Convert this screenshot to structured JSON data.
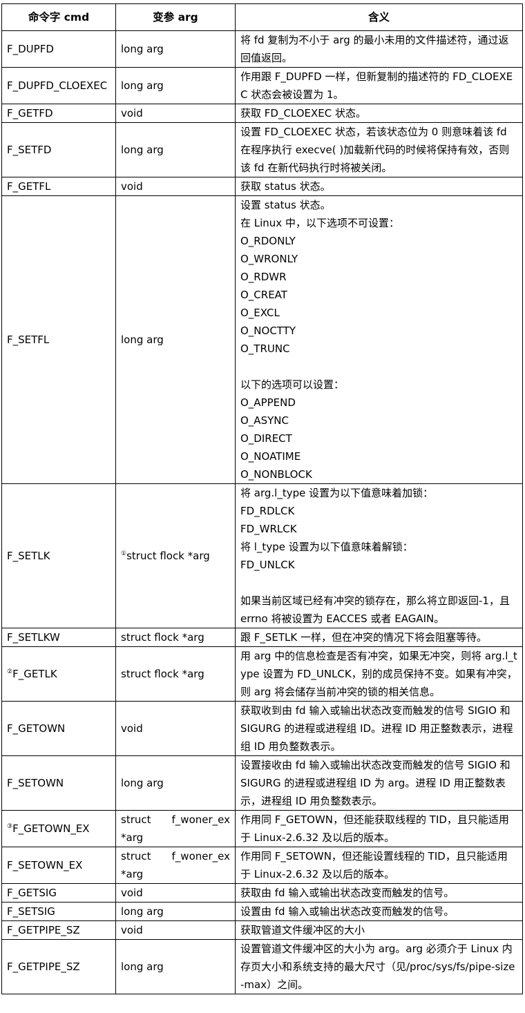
{
  "headers": [
    "命令字 cmd",
    "变参 arg",
    "含义"
  ],
  "rows": [
    {
      "cmd": "F_DUPFD",
      "arg": "long arg",
      "desc": [
        "将 fd 复制为不小于 arg 的最小未用的文件描述符，通过返回值返回。"
      ]
    },
    {
      "cmd": "F_DUPFD_CLOEXEC",
      "arg": "long arg",
      "desc": [
        "作用跟 F_DUPFD 一样，但新复制的描述符的 FD_CLOEXEC 状态会被设置为 1。"
      ]
    },
    {
      "cmd": "F_GETFD",
      "arg": "void",
      "desc": [
        "获取 FD_CLOEXEC 状态。"
      ]
    },
    {
      "cmd": "F_SETFD",
      "arg": "long arg",
      "desc": [
        "设置 FD_CLOEXEC 状态，若该状态位为 0 则意味着该 fd 在程序执行 execve( )加载新代码的时候将保持有效，否则该 fd 在新代码执行时将被关闭。"
      ]
    },
    {
      "cmd": "F_GETFL",
      "arg": "void",
      "desc": [
        "获取 status 状态。"
      ]
    },
    {
      "cmd": "F_SETFL",
      "arg": "long arg",
      "desc": [
        "设置 status 状态。",
        "在 Linux 中，以下选项不可设置：",
        "O_RDONLY",
        "O_WRONLY",
        "O_RDWR",
        "O_CREAT",
        "O_EXCL",
        "O_NOCTTY",
        "O_TRUNC",
        "",
        "以下的选项可以设置：",
        "O_APPEND",
        "O_ASYNC",
        "O_DIRECT",
        "O_NOATIME",
        "O_NONBLOCK"
      ]
    },
    {
      "cmd": "F_SETLK",
      "arg_note": "①",
      "arg": "struct flock *arg",
      "desc": [
        "将 arg.l_type 设置为以下值意味着加锁：",
        "FD_RDLCK",
        "FD_WRLCK",
        "将 l_type 设置为以下值意味着解锁：",
        "FD_UNLCK",
        "",
        "如果当前区域已经有冲突的锁存在，那么将立即返回-1，且 errno 将被设置为 EACCES 或者 EAGAIN。"
      ]
    },
    {
      "cmd": "F_SETLKW",
      "arg": "struct flock *arg",
      "desc": [
        "跟 F_SETLK 一样，但在冲突的情况下将会阻塞等待。"
      ]
    },
    {
      "cmd_note": "②",
      "cmd": "F_GETLK",
      "arg": "struct flock *arg",
      "desc": [
        "用 arg 中的信息检查是否有冲突，如果无冲突，则将 arg.l_type 设置为 FD_UNLCK，别的成员保持不变。如果有冲突，则 arg 将会储存当前冲突的锁的相关信息。"
      ]
    },
    {
      "cmd": "F_GETOWN",
      "arg": "void",
      "desc": [
        "获取收到由 fd 输入或输出状态改变而触发的信号 SIGIO 和 SIGURG 的进程或进程组 ID。进程 ID 用正整数表示，进程组 ID 用负整数表示。"
      ]
    },
    {
      "cmd": "F_SETOWN",
      "arg": "long arg",
      "desc": [
        "设置接收由 fd 输入或输出状态改变而触发的信号 SIGIO 和 SIGURG 的进程或进程组 ID 为 arg。进程 ID 用正整数表示，进程组 ID 用负整数表示。"
      ]
    },
    {
      "cmd_note": "③",
      "cmd": "F_GETOWN_EX",
      "arg_parts": [
        "struct",
        "f_woner_ex",
        "*arg"
      ],
      "desc": [
        "作用同 F_GETOWN，但还能获取线程的 TID，且只能适用于 Linux-2.6.32 及以后的版本。"
      ]
    },
    {
      "cmd": "F_SETOWN_EX",
      "arg_parts": [
        "struct",
        "f_woner_ex",
        "*arg"
      ],
      "desc": [
        "作用同 F_SETOWN，但还能设置线程的 TID，且只能适用于 Linux-2.6.32 及以后的版本。"
      ]
    },
    {
      "cmd": "F_GETSIG",
      "arg": "void",
      "desc": [
        "获取由 fd 输入或输出状态改变而触发的信号。"
      ]
    },
    {
      "cmd": "F_SETSIG",
      "arg": "long arg",
      "desc": [
        "设置由 fd 输入或输出状态改变而触发的信号。"
      ]
    },
    {
      "cmd": "F_GETPIPE_SZ",
      "arg": "void",
      "desc": [
        "获取管道文件缓冲区的大小"
      ]
    },
    {
      "cmd": "F_GETPIPE_SZ",
      "arg": "long arg",
      "desc": [
        "设置管道文件缓冲区的大小为 arg。arg 必须介于 Linux 内存页大小和系统支持的最大尺寸（见/proc/sys/fs/pipe-size-max）之间。"
      ]
    }
  ]
}
